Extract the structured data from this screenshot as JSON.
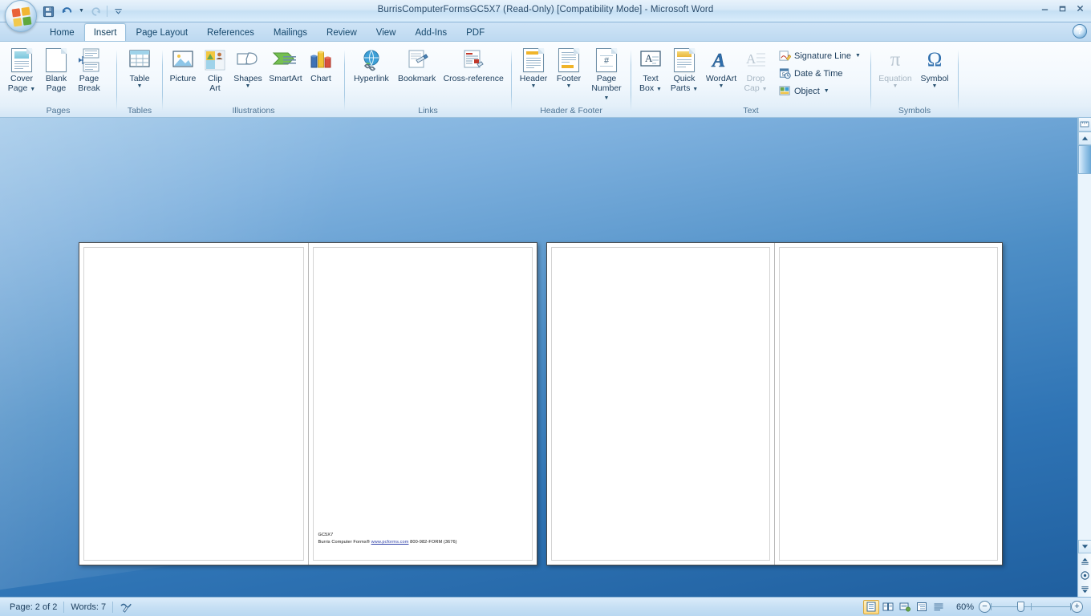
{
  "window": {
    "title": "BurrisComputerFormsGC5X7 (Read-Only) [Compatibility Mode] - Microsoft Word",
    "minimize_label": "–",
    "restore_label": "❐",
    "close_label": "✕",
    "office_button_label": "Office Button"
  },
  "quick_access": {
    "save_label": "Save",
    "undo_label": "Undo",
    "undo_dropdown_label": "Undo options",
    "redo_label": "Redo",
    "customize_label": "Customize Quick Access Toolbar"
  },
  "tabs": [
    {
      "label": "Home",
      "active": false
    },
    {
      "label": "Insert",
      "active": true
    },
    {
      "label": "Page Layout",
      "active": false
    },
    {
      "label": "References",
      "active": false
    },
    {
      "label": "Mailings",
      "active": false
    },
    {
      "label": "Review",
      "active": false
    },
    {
      "label": "View",
      "active": false
    },
    {
      "label": "Add-Ins",
      "active": false
    },
    {
      "label": "PDF",
      "active": false
    }
  ],
  "help_label": "?",
  "ribbon": {
    "groups": {
      "pages": {
        "label": "Pages",
        "cover_page": "Cover\nPage",
        "cover_page_l1": "Cover",
        "cover_page_l2": "Page",
        "blank_page_l1": "Blank",
        "blank_page_l2": "Page",
        "page_break_l1": "Page",
        "page_break_l2": "Break"
      },
      "tables": {
        "label": "Tables",
        "table_label": "Table"
      },
      "illustrations": {
        "label": "Illustrations",
        "picture_label": "Picture",
        "clipart_l1": "Clip",
        "clipart_l2": "Art",
        "shapes_label": "Shapes",
        "smartart_label": "SmartArt",
        "chart_label": "Chart"
      },
      "links": {
        "label": "Links",
        "hyperlink_label": "Hyperlink",
        "bookmark_label": "Bookmark",
        "crossref_label": "Cross-reference"
      },
      "headerfooter": {
        "label": "Header & Footer",
        "header_label": "Header",
        "footer_label": "Footer",
        "pagenumber_l1": "Page",
        "pagenumber_l2": "Number"
      },
      "text": {
        "label": "Text",
        "textbox_l1": "Text",
        "textbox_l2": "Box",
        "quickparts_l1": "Quick",
        "quickparts_l2": "Parts",
        "wordart_label": "WordArt",
        "dropcap_l1": "Drop",
        "dropcap_l2": "Cap",
        "signature_line_label": "Signature Line",
        "date_time_label": "Date & Time",
        "object_label": "Object"
      },
      "symbols": {
        "label": "Symbols",
        "equation_label": "Equation",
        "symbol_label": "Symbol",
        "equation_glyph": "π",
        "symbol_glyph": "Ω"
      }
    }
  },
  "document": {
    "line1": "GC5X7",
    "line2_prefix": "Burris Computer Forms® ",
    "line2_link": "www.pcforms.com",
    "line2_suffix": " 800-982-FORM (3676)"
  },
  "scrollbar": {
    "up_arrow": "▲",
    "down_arrow": "▼",
    "prev_page_label": "Previous Page",
    "select_browse_label": "Select Browse Object",
    "next_page_label": "Next Page",
    "prev_glyph": "≡",
    "next_glyph": "≡",
    "browse_glyph": "◎"
  },
  "statusbar": {
    "page_label": "Page: 2 of 2",
    "words_label": "Words: 7",
    "proofing_label": "Proofing errors check",
    "zoom_label": "60%",
    "zoom_out_label": "−",
    "zoom_in_label": "+",
    "views": [
      {
        "name": "print-layout",
        "selected": true
      },
      {
        "name": "full-screen-reading",
        "selected": false
      },
      {
        "name": "web-layout",
        "selected": false
      },
      {
        "name": "outline",
        "selected": false
      },
      {
        "name": "draft",
        "selected": false
      }
    ]
  },
  "colors": {
    "accent": "#2f74b5",
    "ribbon_bg": "#f2f8fd",
    "title_bg": "#c6e0f4",
    "link": "#2d3fa8"
  }
}
